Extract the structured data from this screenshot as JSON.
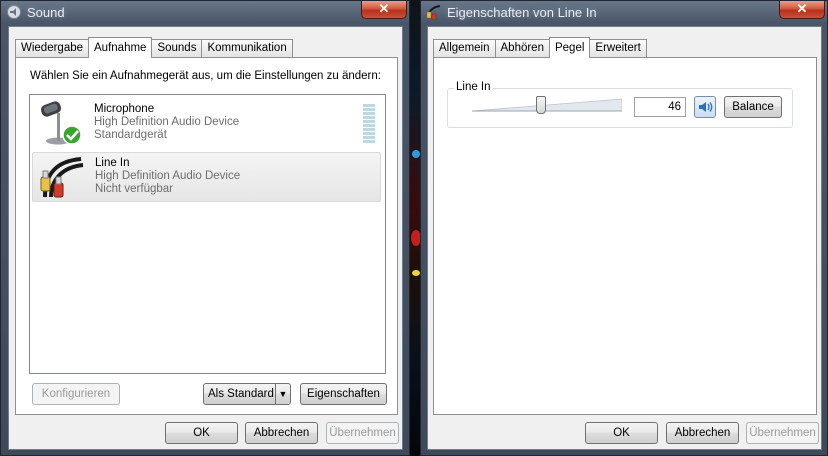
{
  "sound_window": {
    "title": "Sound",
    "close_label": "✕",
    "tabs": [
      {
        "label": "Wiedergabe",
        "active": false
      },
      {
        "label": "Aufnahme",
        "active": true
      },
      {
        "label": "Sounds",
        "active": false
      },
      {
        "label": "Kommunikation",
        "active": false
      }
    ],
    "instruction": "Wählen Sie ein Aufnahmegerät aus, um die Einstellungen zu ändern:",
    "devices": [
      {
        "name": "Microphone",
        "device": "High Definition Audio Device",
        "status": "Standardgerät",
        "icon": "microphone-default-icon",
        "selected": false
      },
      {
        "name": "Line In",
        "device": "High Definition Audio Device",
        "status": "Nicht verfügbar",
        "icon": "line-in-cable-icon",
        "selected": true
      }
    ],
    "buttons": {
      "configure": "Konfigurieren",
      "set_default": "Als Standard",
      "properties": "Eigenschaften",
      "ok": "OK",
      "cancel": "Abbrechen",
      "apply": "Übernehmen"
    }
  },
  "props_window": {
    "title": "Eigenschaften von Line In",
    "close_label": "✕",
    "tabs": [
      {
        "label": "Allgemein",
        "active": false
      },
      {
        "label": "Abhören",
        "active": false
      },
      {
        "label": "Pegel",
        "active": true
      },
      {
        "label": "Erweitert",
        "active": false
      }
    ],
    "level_group": {
      "label": "Line In",
      "value": "46",
      "slider_fraction": 0.46,
      "speaker_icon": "speaker-volume-icon",
      "balance_label": "Balance"
    },
    "buttons": {
      "ok": "OK",
      "cancel": "Abbrechen",
      "apply": "Übernehmen"
    }
  },
  "colors": {
    "accent": "#2a7ae2",
    "selected_row": "#e9e9e9",
    "check_green": "#3aa52e"
  }
}
